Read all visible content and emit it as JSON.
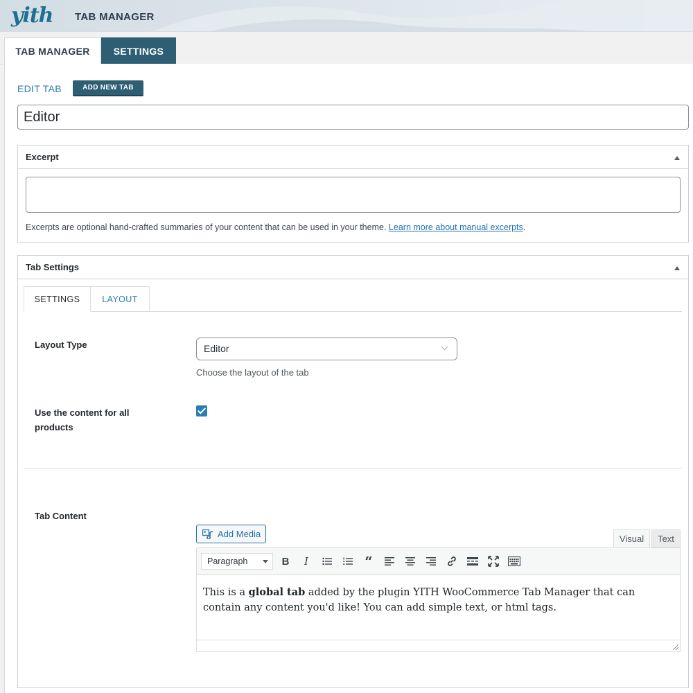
{
  "header": {
    "logo_text": "yith",
    "app_title": "TAB MANAGER"
  },
  "main_tabs": [
    {
      "label": "TAB MANAGER",
      "active": true
    },
    {
      "label": "SETTINGS",
      "active": false
    }
  ],
  "edit": {
    "label": "EDIT TAB",
    "add_new_label": "ADD NEW TAB",
    "title_value": "Editor"
  },
  "excerpt": {
    "title": "Excerpt",
    "value": "",
    "help_text": "Excerpts are optional hand-crafted summaries of your content that can be used in your theme.",
    "help_link": "Learn more about manual excerpts",
    "help_end": "."
  },
  "tab_settings": {
    "title": "Tab Settings",
    "tabs": [
      {
        "label": "SETTINGS",
        "active": true
      },
      {
        "label": "LAYOUT",
        "active": false
      }
    ],
    "layout_type_label": "Layout Type",
    "layout_type_value": "Editor",
    "layout_type_help": "Choose the layout of the tab",
    "use_content_label_1": "Use the content for all",
    "use_content_label_2": "products",
    "use_content_checked": true,
    "tab_content_label": "Tab Content"
  },
  "editor": {
    "add_media_label": "Add Media",
    "mode_visual": "Visual",
    "mode_text": "Text",
    "format_value": "Paragraph",
    "content_before": "This is a ",
    "content_bold": "global tab",
    "content_after": " added by the plugin YITH WooCommerce Tab Manager that can contain any content you'd like! You can add simple text, or html tags."
  },
  "colors": {
    "accent": "#2e5e73",
    "link": "#2a7ea8",
    "checkbox": "#2e7db0"
  }
}
